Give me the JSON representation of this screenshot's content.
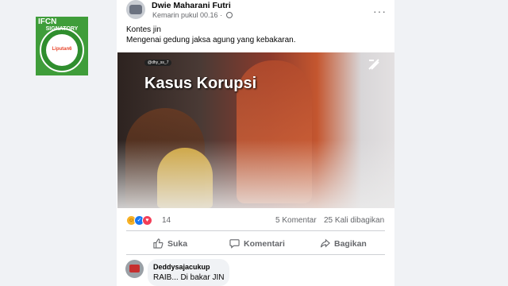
{
  "badge": {
    "heading": "IFCN",
    "arc_text": "SIGNATORY",
    "logo_text": "Liputan6"
  },
  "post": {
    "author": "Dwie Maharani Futri",
    "timestamp": "Kemarin pukul 00.16",
    "privacy_icon": "globe-icon",
    "more_icon": "more-icon",
    "more_label": "···",
    "text_line1": "Kontes jin",
    "text_line2": "Mengenai gedung jaksa agung yang kebakaran.",
    "video": {
      "handle": "@dhy_ss_7",
      "title_overlay": "Kasus Korupsi"
    }
  },
  "stats": {
    "reactions": [
      "haha-icon",
      "like-icon",
      "love-icon"
    ],
    "reaction_count": "14",
    "comments": "5 Komentar",
    "shares": "25 Kali dibagikan"
  },
  "actions": {
    "like": "Suka",
    "comment": "Komentari",
    "share": "Bagikan"
  },
  "comment": {
    "name": "Deddysajacukup",
    "text": "RAIB... Di bakar JIN"
  },
  "colors": {
    "accent": "#1877f2",
    "badge_green": "#3f9d3a",
    "love": "#f33e58",
    "haha": "#f7b125"
  }
}
